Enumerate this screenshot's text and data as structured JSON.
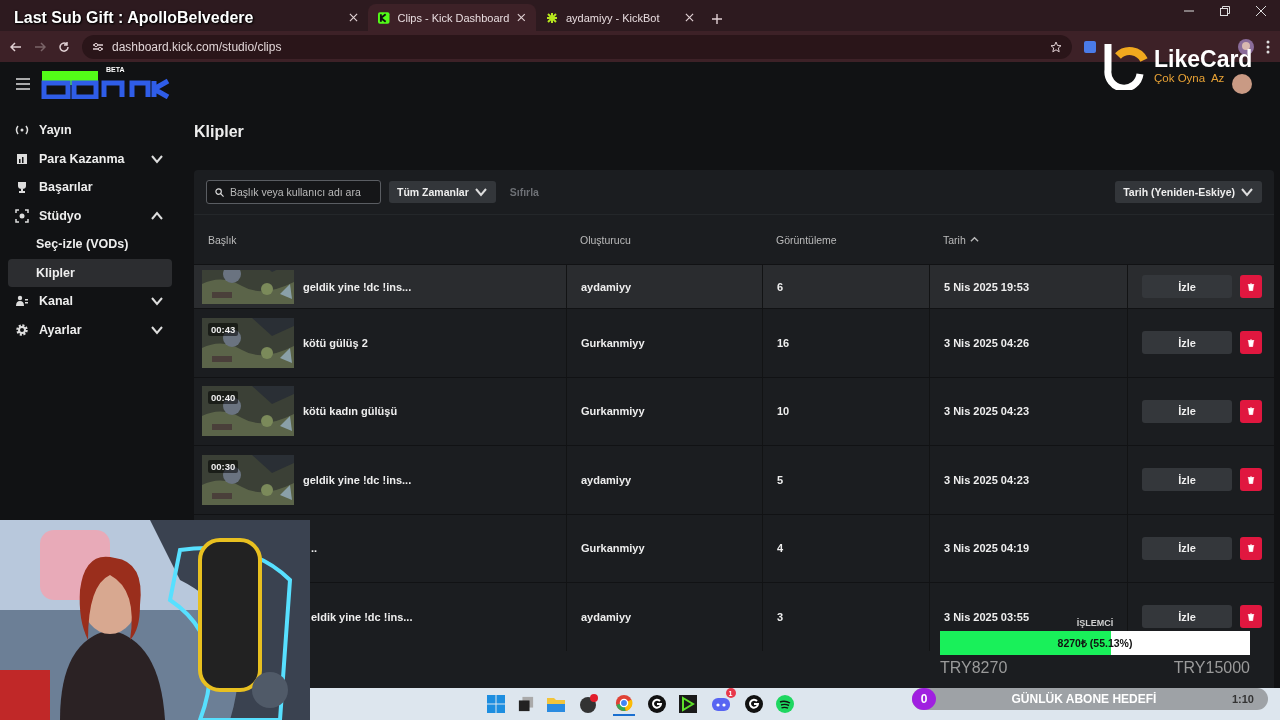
{
  "overlay": {
    "last_sub": "Last Sub Gift : ApolloBelvedere"
  },
  "browser": {
    "tabs": [
      {
        "selected": false
      },
      {
        "title": "Clips - Kick Dashboard",
        "selected": true
      },
      {
        "title": "aydamiyy - KickBot",
        "selected": false
      }
    ],
    "url": "dashboard.kick.com/studio/clips"
  },
  "logo": {
    "beta": "BETA"
  },
  "sidebar": {
    "items": [
      {
        "label": "Yayın"
      },
      {
        "label": "Para Kazanma",
        "expanded": false
      },
      {
        "label": "Başarılar"
      },
      {
        "label": "Stüdyo",
        "expanded": true,
        "children": [
          {
            "label": "Seç-izle (VODs)",
            "selected": false
          },
          {
            "label": "Klipler",
            "selected": true
          }
        ]
      },
      {
        "label": "Kanal",
        "expanded": false
      },
      {
        "label": "Ayarlar",
        "expanded": false
      }
    ]
  },
  "page": {
    "title": "Klipler"
  },
  "filters": {
    "search": {
      "placeholder": "Başlık veya kullanıcı adı ara"
    },
    "time": "Tüm Zamanlar",
    "reset": "Sıfırla",
    "sort": "Tarih (Yeniden-Eskiye)"
  },
  "table": {
    "columns": [
      {
        "label": "Başlık",
        "sorted": false
      },
      {
        "label": "Oluşturucu",
        "sorted": false
      },
      {
        "label": "Görüntüleme",
        "sorted": false
      },
      {
        "label": "Tarih",
        "sorted": true
      }
    ],
    "rows": [
      {
        "thumbnail": true,
        "title": "geldik yine !dc !ins...",
        "creator": "aydamiyy",
        "views": "6",
        "date": "5 Nis 2025 19:53",
        "watch": "İzle",
        "highlighted": true
      },
      {
        "thumbnail": true,
        "duration": "00:43",
        "title": "kötü gülüş 2",
        "creator": "Gurkanmiyy",
        "views": "16",
        "date": "3 Nis 2025 04:26",
        "watch": "İzle",
        "highlighted": false
      },
      {
        "thumbnail": true,
        "duration": "00:40",
        "title": "kötü kadın gülüşü",
        "creator": "Gurkanmiyy",
        "views": "10",
        "date": "3 Nis 2025 04:23",
        "watch": "İzle",
        "highlighted": false
      },
      {
        "thumbnail": true,
        "duration": "00:30",
        "title": "geldik yine !dc !ins...",
        "creator": "aydamiyy",
        "views": "5",
        "date": "3 Nis 2025 04:23",
        "watch": "İzle",
        "highlighted": false
      },
      {
        "thumbnail": false,
        "title": "..",
        "creator": "Gurkanmiyy",
        "views": "4",
        "date": "3 Nis 2025 04:19",
        "watch": "İzle",
        "highlighted": false
      },
      {
        "thumbnail": false,
        "title": "eldik yine !dc !ins...",
        "creator": "aydamiyy",
        "views": "3",
        "date": "3 Nis 2025 03:55",
        "watch": "İzle",
        "highlighted": false
      }
    ]
  },
  "likecard": {
    "name": "LikeCard",
    "slogan": "Çok Oyna  Az"
  },
  "goal": {
    "label": "İŞLEMCİ",
    "bar_text": "8270₺ (55.13%)",
    "level": 0.5513,
    "current": "TRY8270",
    "target": "TRY15000"
  },
  "sub_goal": {
    "count": "0",
    "label": "GÜNLÜK ABONE HEDEFİ"
  },
  "clock": {
    "time": "1:10"
  },
  "taskbar": {
    "badge": "1"
  }
}
